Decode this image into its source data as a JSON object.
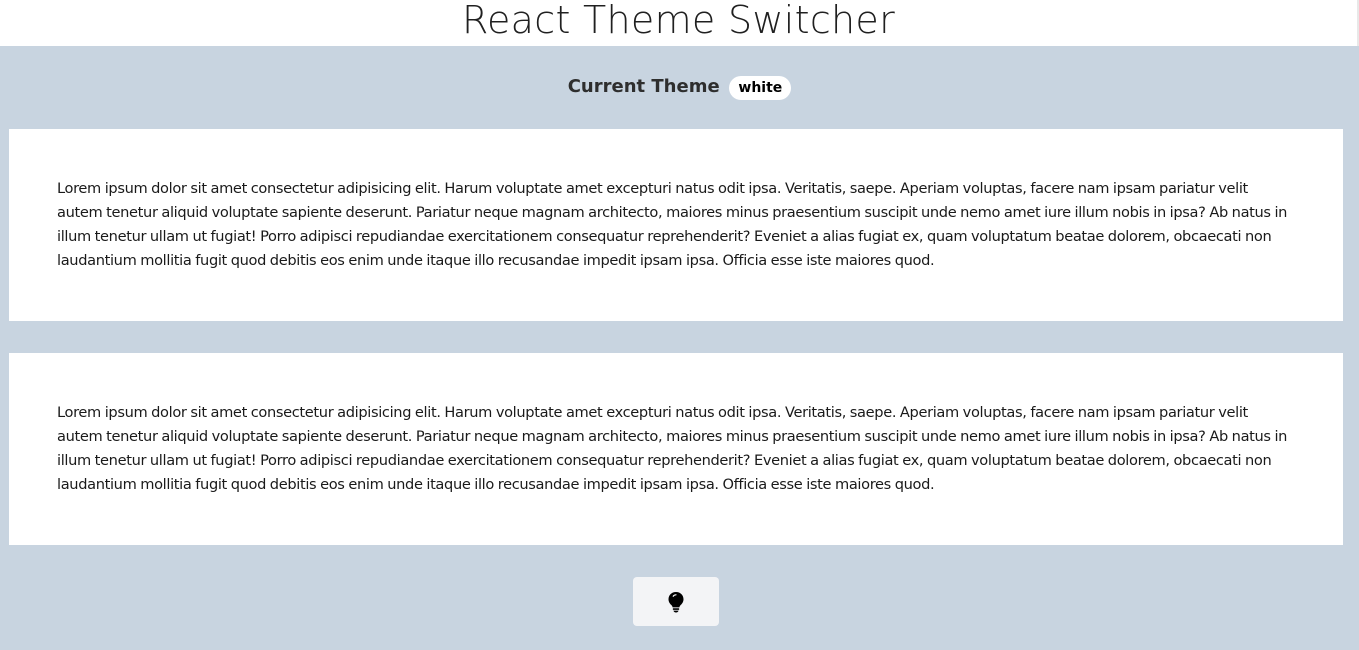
{
  "header": {
    "title": "React Theme Switcher"
  },
  "theme": {
    "label": "Current Theme",
    "value": "white"
  },
  "cards": [
    {
      "text": "Lorem ipsum dolor sit amet consectetur adipisicing elit. Harum voluptate amet excepturi natus odit ipsa. Veritatis, saepe. Aperiam voluptas, facere nam ipsam pariatur velit autem tenetur aliquid voluptate sapiente deserunt. Pariatur neque magnam architecto, maiores minus praesentium suscipit unde nemo amet iure illum nobis in ipsa? Ab natus in illum tenetur ullam ut fugiat! Porro adipisci repudiandae exercitationem consequatur reprehenderit? Eveniet a alias fugiat ex, quam voluptatum beatae dolorem, obcaecati non laudantium mollitia fugit quod debitis eos enim unde itaque illo recusandae impedit ipsam ipsa. Officia esse iste maiores quod."
    },
    {
      "text": "Lorem ipsum dolor sit amet consectetur adipisicing elit. Harum voluptate amet excepturi natus odit ipsa. Veritatis, saepe. Aperiam voluptas, facere nam ipsam pariatur velit autem tenetur aliquid voluptate sapiente deserunt. Pariatur neque magnam architecto, maiores minus praesentium suscipit unde nemo amet iure illum nobis in ipsa? Ab natus in illum tenetur ullam ut fugiat! Porro adipisci repudiandae exercitationem consequatur reprehenderit? Eveniet a alias fugiat ex, quam voluptatum beatae dolorem, obcaecati non laudantium mollitia fugit quod debitis eos enim unde itaque illo recusandae impedit ipsam ipsa. Officia esse iste maiores quod."
    }
  ],
  "toggle": {
    "icon": "lightbulb-icon"
  },
  "colors": {
    "page_background": "#c8d4e0",
    "card_background": "#ffffff",
    "header_background": "#ffffff",
    "button_background": "#f3f4f6"
  }
}
